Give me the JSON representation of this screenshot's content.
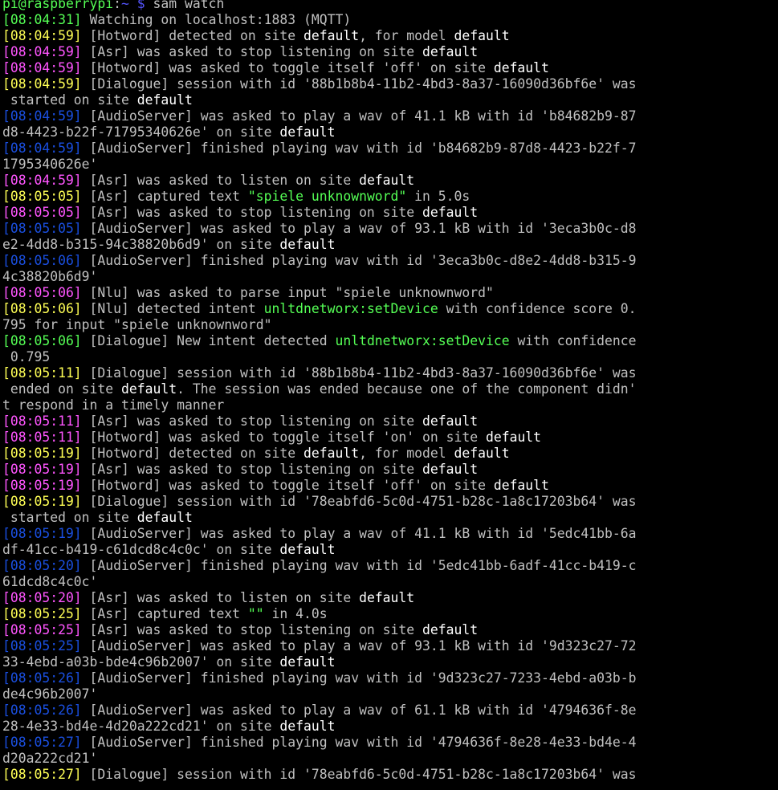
{
  "colors": {
    "background": "#000000",
    "default_text": "#c0c0c0",
    "bright": "#ffffff",
    "prompt_user": "#55ff55",
    "prompt_path": "#5555ff",
    "timestamp_info": "#55ff55",
    "timestamp_yellow": "#ffff55",
    "timestamp_magenta": "#ff55ff",
    "timestamp_blue": "#1a4fe0",
    "highlight_green": "#55ff55"
  },
  "terminal": {
    "title": "sam watch",
    "lines": [
      {
        "type": "prompt",
        "segments": [
          {
            "text": "pi@raspberrypi",
            "color": "prompt_user"
          },
          {
            "text": ":",
            "color": "default_text"
          },
          {
            "text": "~ $",
            "color": "prompt_path"
          },
          {
            "text": " sam watch",
            "color": "default_text"
          }
        ]
      },
      {
        "type": "log",
        "segments": [
          {
            "text": "[08:04:31]",
            "color": "timestamp_info"
          },
          {
            "text": " Watching on localhost:1883 (MQTT)",
            "color": "default_text"
          }
        ]
      },
      {
        "type": "log",
        "segments": [
          {
            "text": "[08:04:59]",
            "color": "timestamp_yellow"
          },
          {
            "text": " [Hotword] detected on site ",
            "color": "default_text"
          },
          {
            "text": "default",
            "color": "bright"
          },
          {
            "text": ", for model ",
            "color": "default_text"
          },
          {
            "text": "default",
            "color": "bright"
          }
        ]
      },
      {
        "type": "log",
        "segments": [
          {
            "text": "[08:04:59]",
            "color": "timestamp_magenta"
          },
          {
            "text": " [Asr] was asked to stop listening on site ",
            "color": "default_text"
          },
          {
            "text": "default",
            "color": "bright"
          }
        ]
      },
      {
        "type": "log",
        "segments": [
          {
            "text": "[08:04:59]",
            "color": "timestamp_magenta"
          },
          {
            "text": " [Hotword] was asked to toggle itself 'off' on site ",
            "color": "default_text"
          },
          {
            "text": "default",
            "color": "bright"
          }
        ]
      },
      {
        "type": "log",
        "segments": [
          {
            "text": "[08:04:59]",
            "color": "timestamp_yellow"
          },
          {
            "text": " [Dialogue] session with id '88b1b8b4-11b2-4bd3-8a37-16090d36bf6e' was",
            "color": "default_text"
          }
        ]
      },
      {
        "type": "cont",
        "segments": [
          {
            "text": " started on site ",
            "color": "default_text"
          },
          {
            "text": "default",
            "color": "bright"
          }
        ]
      },
      {
        "type": "log",
        "segments": [
          {
            "text": "[08:04:59]",
            "color": "timestamp_blue"
          },
          {
            "text": " [AudioServer] was asked to play a wav of 41.1 kB with id 'b84682b9-87",
            "color": "default_text"
          }
        ]
      },
      {
        "type": "cont",
        "segments": [
          {
            "text": "d8-4423-b22f-71795340626e' on site ",
            "color": "default_text"
          },
          {
            "text": "default",
            "color": "bright"
          }
        ]
      },
      {
        "type": "log",
        "segments": [
          {
            "text": "[08:04:59]",
            "color": "timestamp_blue"
          },
          {
            "text": " [AudioServer] finished playing wav with id 'b84682b9-87d8-4423-b22f-7",
            "color": "default_text"
          }
        ]
      },
      {
        "type": "cont",
        "segments": [
          {
            "text": "1795340626e'",
            "color": "default_text"
          }
        ]
      },
      {
        "type": "log",
        "segments": [
          {
            "text": "[08:04:59]",
            "color": "timestamp_magenta"
          },
          {
            "text": " [Asr] was asked to listen on site ",
            "color": "default_text"
          },
          {
            "text": "default",
            "color": "bright"
          }
        ]
      },
      {
        "type": "log",
        "segments": [
          {
            "text": "[08:05:05]",
            "color": "timestamp_yellow"
          },
          {
            "text": " [Asr] captured text ",
            "color": "default_text"
          },
          {
            "text": "\"spiele unknownword\"",
            "color": "highlight_green"
          },
          {
            "text": " in 5.0s",
            "color": "default_text"
          }
        ]
      },
      {
        "type": "log",
        "segments": [
          {
            "text": "[08:05:05]",
            "color": "timestamp_magenta"
          },
          {
            "text": " [Asr] was asked to stop listening on site ",
            "color": "default_text"
          },
          {
            "text": "default",
            "color": "bright"
          }
        ]
      },
      {
        "type": "log",
        "segments": [
          {
            "text": "[08:05:05]",
            "color": "timestamp_blue"
          },
          {
            "text": " [AudioServer] was asked to play a wav of 93.1 kB with id '3eca3b0c-d8",
            "color": "default_text"
          }
        ]
      },
      {
        "type": "cont",
        "segments": [
          {
            "text": "e2-4dd8-b315-94c38820b6d9' on site ",
            "color": "default_text"
          },
          {
            "text": "default",
            "color": "bright"
          }
        ]
      },
      {
        "type": "log",
        "segments": [
          {
            "text": "[08:05:06]",
            "color": "timestamp_blue"
          },
          {
            "text": " [AudioServer] finished playing wav with id '3eca3b0c-d8e2-4dd8-b315-9",
            "color": "default_text"
          }
        ]
      },
      {
        "type": "cont",
        "segments": [
          {
            "text": "4c38820b6d9'",
            "color": "default_text"
          }
        ]
      },
      {
        "type": "log",
        "segments": [
          {
            "text": "[08:05:06]",
            "color": "timestamp_magenta"
          },
          {
            "text": " [Nlu] was asked to parse input \"spiele unknownword\"",
            "color": "default_text"
          }
        ]
      },
      {
        "type": "log",
        "segments": [
          {
            "text": "[08:05:06]",
            "color": "timestamp_yellow"
          },
          {
            "text": " [Nlu] detected intent ",
            "color": "default_text"
          },
          {
            "text": "unltdnetworx:setDevice",
            "color": "highlight_green"
          },
          {
            "text": " with confidence score 0.",
            "color": "default_text"
          }
        ]
      },
      {
        "type": "cont",
        "segments": [
          {
            "text": "795 for input \"spiele unknownword\"",
            "color": "default_text"
          }
        ]
      },
      {
        "type": "log",
        "segments": [
          {
            "text": "[08:05:06]",
            "color": "timestamp_info"
          },
          {
            "text": " [Dialogue] New intent detected ",
            "color": "default_text"
          },
          {
            "text": "unltdnetworx:setDevice",
            "color": "highlight_green"
          },
          {
            "text": " with confidence",
            "color": "default_text"
          }
        ]
      },
      {
        "type": "cont",
        "segments": [
          {
            "text": " 0.795",
            "color": "default_text"
          }
        ]
      },
      {
        "type": "log",
        "segments": [
          {
            "text": "[08:05:11]",
            "color": "timestamp_yellow"
          },
          {
            "text": " [Dialogue] session with id '88b1b8b4-11b2-4bd3-8a37-16090d36bf6e' was",
            "color": "default_text"
          }
        ]
      },
      {
        "type": "cont",
        "segments": [
          {
            "text": " ended on site ",
            "color": "default_text"
          },
          {
            "text": "default",
            "color": "bright"
          },
          {
            "text": ". The session was ended because one of the component didn'",
            "color": "default_text"
          }
        ]
      },
      {
        "type": "cont",
        "segments": [
          {
            "text": "t respond in a timely manner",
            "color": "default_text"
          }
        ]
      },
      {
        "type": "log",
        "segments": [
          {
            "text": "[08:05:11]",
            "color": "timestamp_magenta"
          },
          {
            "text": " [Asr] was asked to stop listening on site ",
            "color": "default_text"
          },
          {
            "text": "default",
            "color": "bright"
          }
        ]
      },
      {
        "type": "log",
        "segments": [
          {
            "text": "[08:05:11]",
            "color": "timestamp_magenta"
          },
          {
            "text": " [Hotword] was asked to toggle itself 'on' on site ",
            "color": "default_text"
          },
          {
            "text": "default",
            "color": "bright"
          }
        ]
      },
      {
        "type": "log",
        "segments": [
          {
            "text": "[08:05:19]",
            "color": "timestamp_yellow"
          },
          {
            "text": " [Hotword] detected on site ",
            "color": "default_text"
          },
          {
            "text": "default",
            "color": "bright"
          },
          {
            "text": ", for model ",
            "color": "default_text"
          },
          {
            "text": "default",
            "color": "bright"
          }
        ]
      },
      {
        "type": "log",
        "segments": [
          {
            "text": "[08:05:19]",
            "color": "timestamp_magenta"
          },
          {
            "text": " [Asr] was asked to stop listening on site ",
            "color": "default_text"
          },
          {
            "text": "default",
            "color": "bright"
          }
        ]
      },
      {
        "type": "log",
        "segments": [
          {
            "text": "[08:05:19]",
            "color": "timestamp_magenta"
          },
          {
            "text": " [Hotword] was asked to toggle itself 'off' on site ",
            "color": "default_text"
          },
          {
            "text": "default",
            "color": "bright"
          }
        ]
      },
      {
        "type": "log",
        "segments": [
          {
            "text": "[08:05:19]",
            "color": "timestamp_yellow"
          },
          {
            "text": " [Dialogue] session with id '78eabfd6-5c0d-4751-b28c-1a8c17203b64' was",
            "color": "default_text"
          }
        ]
      },
      {
        "type": "cont",
        "segments": [
          {
            "text": " started on site ",
            "color": "default_text"
          },
          {
            "text": "default",
            "color": "bright"
          }
        ]
      },
      {
        "type": "log",
        "segments": [
          {
            "text": "[08:05:19]",
            "color": "timestamp_blue"
          },
          {
            "text": " [AudioServer] was asked to play a wav of 41.1 kB with id '5edc41bb-6a",
            "color": "default_text"
          }
        ]
      },
      {
        "type": "cont",
        "segments": [
          {
            "text": "df-41cc-b419-c61dcd8c4c0c' on site ",
            "color": "default_text"
          },
          {
            "text": "default",
            "color": "bright"
          }
        ]
      },
      {
        "type": "log",
        "segments": [
          {
            "text": "[08:05:20]",
            "color": "timestamp_blue"
          },
          {
            "text": " [AudioServer] finished playing wav with id '5edc41bb-6adf-41cc-b419-c",
            "color": "default_text"
          }
        ]
      },
      {
        "type": "cont",
        "segments": [
          {
            "text": "61dcd8c4c0c'",
            "color": "default_text"
          }
        ]
      },
      {
        "type": "log",
        "segments": [
          {
            "text": "[08:05:20]",
            "color": "timestamp_magenta"
          },
          {
            "text": " [Asr] was asked to listen on site ",
            "color": "default_text"
          },
          {
            "text": "default",
            "color": "bright"
          }
        ]
      },
      {
        "type": "log",
        "segments": [
          {
            "text": "[08:05:25]",
            "color": "timestamp_yellow"
          },
          {
            "text": " [Asr] captured text ",
            "color": "default_text"
          },
          {
            "text": "\"\"",
            "color": "highlight_green"
          },
          {
            "text": " in 4.0s",
            "color": "default_text"
          }
        ]
      },
      {
        "type": "log",
        "segments": [
          {
            "text": "[08:05:25]",
            "color": "timestamp_magenta"
          },
          {
            "text": " [Asr] was asked to stop listening on site ",
            "color": "default_text"
          },
          {
            "text": "default",
            "color": "bright"
          }
        ]
      },
      {
        "type": "log",
        "segments": [
          {
            "text": "[08:05:25]",
            "color": "timestamp_blue"
          },
          {
            "text": " [AudioServer] was asked to play a wav of 93.1 kB with id '9d323c27-72",
            "color": "default_text"
          }
        ]
      },
      {
        "type": "cont",
        "segments": [
          {
            "text": "33-4ebd-a03b-bde4c96b2007' on site ",
            "color": "default_text"
          },
          {
            "text": "default",
            "color": "bright"
          }
        ]
      },
      {
        "type": "log",
        "segments": [
          {
            "text": "[08:05:26]",
            "color": "timestamp_blue"
          },
          {
            "text": " [AudioServer] finished playing wav with id '9d323c27-7233-4ebd-a03b-b",
            "color": "default_text"
          }
        ]
      },
      {
        "type": "cont",
        "segments": [
          {
            "text": "de4c96b2007'",
            "color": "default_text"
          }
        ]
      },
      {
        "type": "log",
        "segments": [
          {
            "text": "[08:05:26]",
            "color": "timestamp_blue"
          },
          {
            "text": " [AudioServer] was asked to play a wav of 61.1 kB with id '4794636f-8e",
            "color": "default_text"
          }
        ]
      },
      {
        "type": "cont",
        "segments": [
          {
            "text": "28-4e33-bd4e-4d20a222cd21' on site ",
            "color": "default_text"
          },
          {
            "text": "default",
            "color": "bright"
          }
        ]
      },
      {
        "type": "log",
        "segments": [
          {
            "text": "[08:05:27]",
            "color": "timestamp_blue"
          },
          {
            "text": " [AudioServer] finished playing wav with id '4794636f-8e28-4e33-bd4e-4",
            "color": "default_text"
          }
        ]
      },
      {
        "type": "cont",
        "segments": [
          {
            "text": "d20a222cd21'",
            "color": "default_text"
          }
        ]
      },
      {
        "type": "log",
        "segments": [
          {
            "text": "[08:05:27]",
            "color": "timestamp_yellow"
          },
          {
            "text": " [Dialogue] session with id '78eabfd6-5c0d-4751-b28c-1a8c17203b64' was",
            "color": "default_text"
          }
        ]
      }
    ]
  }
}
